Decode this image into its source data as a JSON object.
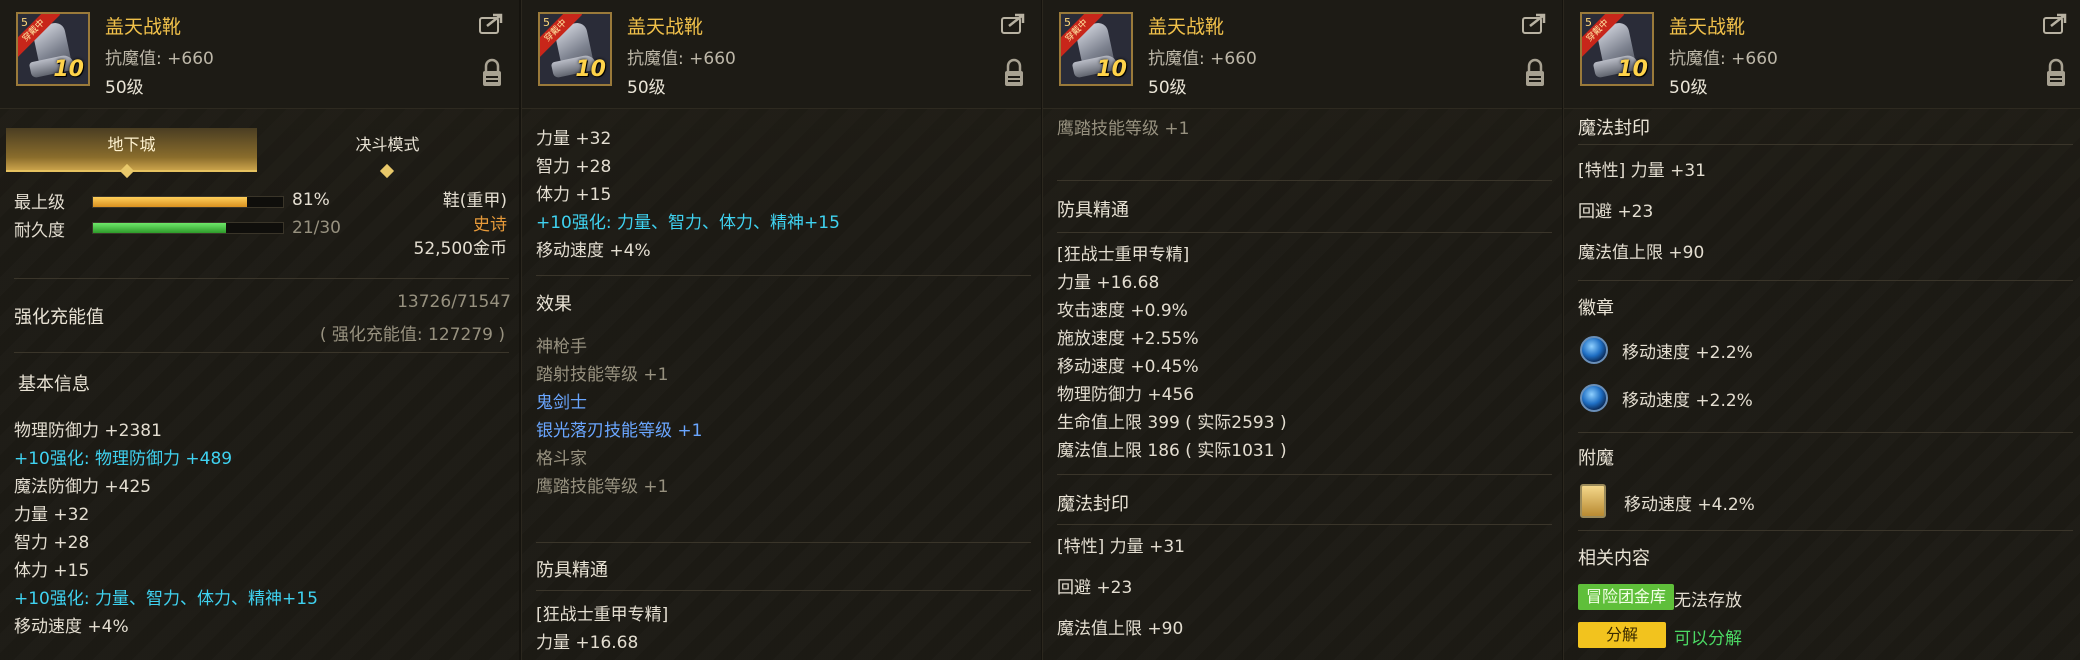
{
  "item": {
    "name": "盖天战靴",
    "stat": "抗魔值: +660",
    "level": "50级",
    "icon_level": "10",
    "icon_ribbon": "穿戴中",
    "icon_tier": "5"
  },
  "panel1": {
    "tabs": [
      "地下城",
      "决斗模式"
    ],
    "upgrade_label": "最上级",
    "upgrade_pct": "81%",
    "upgrade_value": 0.81,
    "durability_label": "耐久度",
    "durability_text": "21/30",
    "durability_value": 0.7,
    "slot": "鞋(重甲)",
    "rarity": "史诗",
    "price": "52,500金币",
    "charge_title": "强化充能值",
    "charge_value": "13726/71547",
    "charge_detail": "( 强化充能值: 127279 )",
    "basic_title": "基本信息",
    "basic": [
      {
        "text": "物理防御力 +2381",
        "color": "normal"
      },
      {
        "text": "+10强化: 物理防御力 +489",
        "color": "cyan"
      },
      {
        "text": "魔法防御力 +425",
        "color": "normal"
      },
      {
        "text": "力量 +32",
        "color": "normal"
      },
      {
        "text": "智力 +28",
        "color": "normal"
      },
      {
        "text": "体力 +15",
        "color": "normal"
      },
      {
        "text": "+10强化: 力量、智力、体力、精神+15",
        "color": "cyan"
      },
      {
        "text": "移动速度 +4%",
        "color": "normal"
      }
    ]
  },
  "panel2": {
    "top": [
      {
        "text": "力量 +32",
        "color": "normal"
      },
      {
        "text": "智力 +28",
        "color": "normal"
      },
      {
        "text": "体力 +15",
        "color": "normal"
      },
      {
        "text": "+10强化: 力量、智力、体力、精神+15",
        "color": "cyan"
      },
      {
        "text": "移动速度 +4%",
        "color": "normal"
      }
    ],
    "effect_title": "效果",
    "effects": [
      {
        "text": "神枪手",
        "color": "grey"
      },
      {
        "text": "踏射技能等级 +1",
        "color": "grey"
      },
      {
        "text": "鬼剑士",
        "color": "blue"
      },
      {
        "text": "银光落刃技能等级 +1",
        "color": "blue"
      },
      {
        "text": "格斗家",
        "color": "grey"
      },
      {
        "text": "鹰踏技能等级 +1",
        "color": "grey"
      }
    ],
    "mastery_title": "防具精通",
    "mastery": [
      "[狂战士重甲专精]",
      "力量 +16.68"
    ]
  },
  "panel3": {
    "top": "鹰踏技能等级 +1",
    "mastery_title": "防具精通",
    "mastery": [
      "[狂战士重甲专精]",
      "力量 +16.68",
      "攻击速度 +0.9%",
      "施放速度 +2.55%",
      "移动速度 +0.45%",
      "物理防御力 +456",
      "生命值上限 399 ( 实际2593 )",
      "魔法值上限 186 ( 实际1031 )"
    ],
    "seal_title": "魔法封印",
    "seal": [
      "[特性] 力量 +31",
      "回避 +23",
      "魔法值上限 +90"
    ]
  },
  "panel4": {
    "seal_title": "魔法封印",
    "seal": [
      "[特性] 力量 +31",
      "回避 +23",
      "魔法值上限 +90"
    ],
    "emblem_title": "徽章",
    "emblems": [
      "移动速度 +2.2%",
      "移动速度 +2.2%"
    ],
    "enchant_title": "附魔",
    "enchant": "移动速度 +4.2%",
    "related_title": "相关内容",
    "vault_label": "冒险团金库",
    "vault_status": "无法存放",
    "disassemble_label": "分解",
    "disassemble_status": "可以分解"
  }
}
